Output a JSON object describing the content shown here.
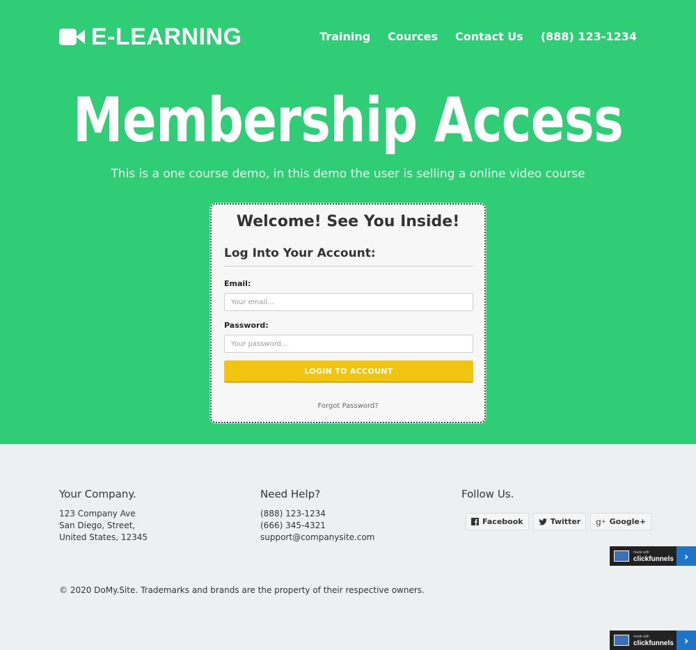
{
  "header": {
    "logo_text": "E-LEARNING",
    "nav": [
      {
        "label": "Training"
      },
      {
        "label": "Cources"
      },
      {
        "label": "Contact Us"
      },
      {
        "label": "(888) 123-1234"
      }
    ]
  },
  "hero": {
    "title": "Membership Access",
    "subtitle": "This is a one course demo, in this demo the user is selling a online video course"
  },
  "login": {
    "title": "Welcome! See You Inside!",
    "subtitle": "Log Into Your Account:",
    "email_label": "Email:",
    "email_placeholder": "Your email...",
    "password_label": "Password:",
    "password_placeholder": "Your password...",
    "button_label": "LOGIN TO ACCOUNT",
    "forgot_link": "Forgot Password?"
  },
  "footer": {
    "company": {
      "heading": "Your Company.",
      "lines": [
        "123 Company Ave",
        "San Diego, Street,",
        "United States, 12345"
      ]
    },
    "help": {
      "heading": "Need Help?",
      "lines": [
        "(888) 123-1234",
        "(666) 345-4321",
        "support@companysite.com"
      ]
    },
    "follow": {
      "heading": "Follow Us.",
      "buttons": [
        {
          "label": "Facebook",
          "icon": "facebook-icon"
        },
        {
          "label": "Twitter",
          "icon": "twitter-icon"
        },
        {
          "label": "Google+",
          "icon": "google-plus-icon"
        }
      ]
    },
    "copyright": "© 2020 DoMy.Site. Trademarks and brands are the property of their respective owners."
  },
  "badge": {
    "small_text": "made with",
    "brand": "clickfunnels"
  },
  "colors": {
    "hero_bg": "#2fce76",
    "button": "#f1c40f",
    "footer_bg": "#eeeff0"
  }
}
